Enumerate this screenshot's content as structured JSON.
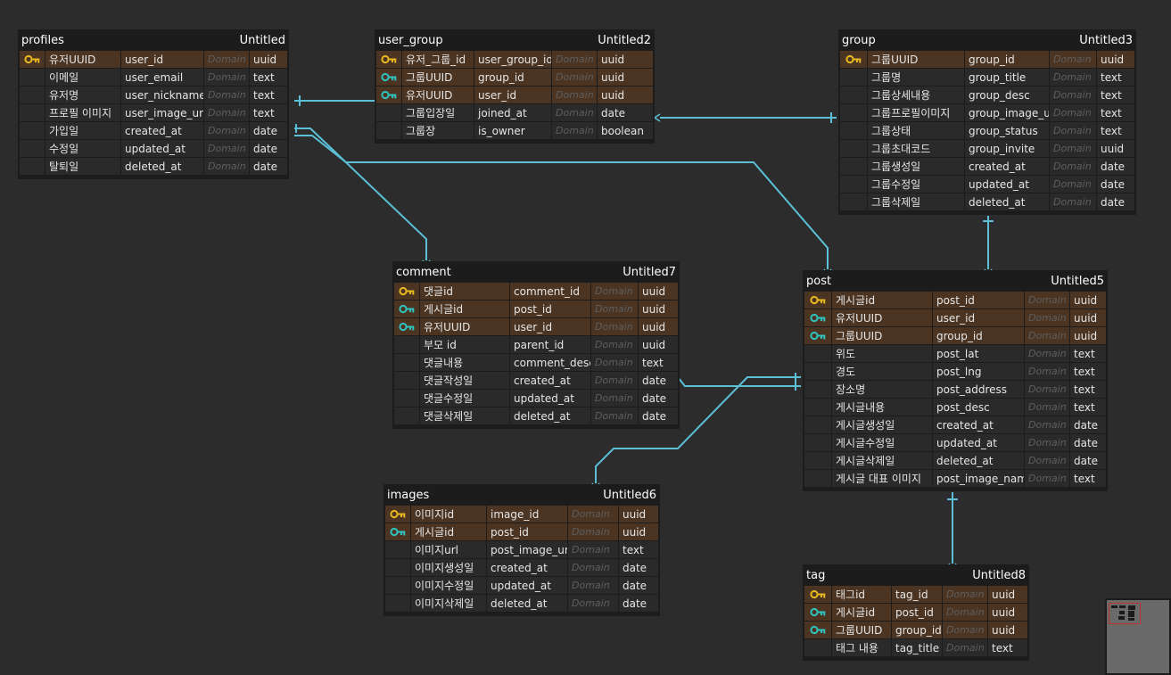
{
  "colors": {
    "background": "#2c2c2c",
    "table_bg": "#1c1c1c",
    "pk_row": "#4b3422",
    "row": "#2a2a2a",
    "link": "#5bc0d6",
    "primary_key_icon": "#e8b820",
    "foreign_key_icon": "#2fc3c0"
  },
  "tables": [
    {
      "id": "profiles",
      "name": "profiles",
      "label": "Untitled",
      "rows": [
        {
          "key": "primary-key-icon",
          "logical": "유저UUID",
          "physical": "user_id",
          "domain": "Domain",
          "type": "uuid"
        },
        {
          "key": "",
          "logical": "이메일",
          "physical": "user_email",
          "domain": "Domain",
          "type": "text"
        },
        {
          "key": "",
          "logical": "유저명",
          "physical": "user_nickname",
          "domain": "Domain",
          "type": "text"
        },
        {
          "key": "",
          "logical": "프로필 이미지",
          "physical": "user_image_url",
          "domain": "Domain",
          "type": "text"
        },
        {
          "key": "",
          "logical": "가입일",
          "physical": "created_at",
          "domain": "Domain",
          "type": "date"
        },
        {
          "key": "",
          "logical": "수정일",
          "physical": "updated_at",
          "domain": "Domain",
          "type": "date"
        },
        {
          "key": "",
          "logical": "탈퇴일",
          "physical": "deleted_at",
          "domain": "Domain",
          "type": "date"
        }
      ]
    },
    {
      "id": "user_group",
      "name": "user_group",
      "label": "Untitled2",
      "rows": [
        {
          "key": "primary-key-icon",
          "logical": "유저_그룹_id",
          "physical": "user_group_id",
          "domain": "Domain",
          "type": "uuid"
        },
        {
          "key": "foreign-key-icon",
          "logical": "그룹UUID",
          "physical": "group_id",
          "domain": "Domain",
          "type": "uuid"
        },
        {
          "key": "foreign-key-icon",
          "logical": "유저UUID",
          "physical": "user_id",
          "domain": "Domain",
          "type": "uuid"
        },
        {
          "key": "",
          "logical": "그룹입장일",
          "physical": "joined_at",
          "domain": "Domain",
          "type": "date"
        },
        {
          "key": "",
          "logical": "그룹장",
          "physical": "is_owner",
          "domain": "Domain",
          "type": "boolean"
        }
      ]
    },
    {
      "id": "group",
      "name": "group",
      "label": "Untitled3",
      "rows": [
        {
          "key": "primary-key-icon",
          "logical": "그룹UUID",
          "physical": "group_id",
          "domain": "Domain",
          "type": "uuid"
        },
        {
          "key": "",
          "logical": "그룹명",
          "physical": "group_title",
          "domain": "Domain",
          "type": "text"
        },
        {
          "key": "",
          "logical": "그룹상세내용",
          "physical": "group_desc",
          "domain": "Domain",
          "type": "text"
        },
        {
          "key": "",
          "logical": "그룹프로필이미지",
          "physical": "group_image_url",
          "domain": "Domain",
          "type": "text"
        },
        {
          "key": "",
          "logical": "그룹상태",
          "physical": "group_status",
          "domain": "Domain",
          "type": "text"
        },
        {
          "key": "",
          "logical": "그룹초대코드",
          "physical": "group_invite",
          "domain": "Domain",
          "type": "uuid"
        },
        {
          "key": "",
          "logical": "그룹생성일",
          "physical": "created_at",
          "domain": "Domain",
          "type": "date"
        },
        {
          "key": "",
          "logical": "그룹수정일",
          "physical": "updated_at",
          "domain": "Domain",
          "type": "date"
        },
        {
          "key": "",
          "logical": "그룹삭제일",
          "physical": "deleted_at",
          "domain": "Domain",
          "type": "date"
        }
      ]
    },
    {
      "id": "comment",
      "name": "comment",
      "label": "Untitled7",
      "rows": [
        {
          "key": "primary-key-icon",
          "logical": "댓글id",
          "physical": "comment_id",
          "domain": "Domain",
          "type": "uuid"
        },
        {
          "key": "foreign-key-icon",
          "logical": "게시글id",
          "physical": "post_id",
          "domain": "Domain",
          "type": "uuid"
        },
        {
          "key": "foreign-key-icon",
          "logical": "유저UUID",
          "physical": "user_id",
          "domain": "Domain",
          "type": "uuid"
        },
        {
          "key": "",
          "logical": "부모 id",
          "physical": "parent_id",
          "domain": "Domain",
          "type": "uuid"
        },
        {
          "key": "",
          "logical": "댓글내용",
          "physical": "comment_desc",
          "domain": "Domain",
          "type": "text"
        },
        {
          "key": "",
          "logical": "댓글작성일",
          "physical": "created_at",
          "domain": "Domain",
          "type": "date"
        },
        {
          "key": "",
          "logical": "댓글수정일",
          "physical": "updated_at",
          "domain": "Domain",
          "type": "date"
        },
        {
          "key": "",
          "logical": "댓글삭제일",
          "physical": "deleted_at",
          "domain": "Domain",
          "type": "date"
        }
      ]
    },
    {
      "id": "post",
      "name": "post",
      "label": "Untitled5",
      "rows": [
        {
          "key": "primary-key-icon",
          "logical": "게시글id",
          "physical": "post_id",
          "domain": "Domain",
          "type": "uuid"
        },
        {
          "key": "foreign-key-icon",
          "logical": "유저UUID",
          "physical": "user_id",
          "domain": "Domain",
          "type": "uuid"
        },
        {
          "key": "foreign-key-icon",
          "logical": "그룹UUID",
          "physical": "group_id",
          "domain": "Domain",
          "type": "uuid"
        },
        {
          "key": "",
          "logical": "위도",
          "physical": "post_lat",
          "domain": "Domain",
          "type": "text"
        },
        {
          "key": "",
          "logical": "경도",
          "physical": "post_lng",
          "domain": "Domain",
          "type": "text"
        },
        {
          "key": "",
          "logical": "장소명",
          "physical": "post_address",
          "domain": "Domain",
          "type": "text"
        },
        {
          "key": "",
          "logical": "게시글내용",
          "physical": "post_desc",
          "domain": "Domain",
          "type": "text"
        },
        {
          "key": "",
          "logical": "게시글생성일",
          "physical": "created_at",
          "domain": "Domain",
          "type": "date"
        },
        {
          "key": "",
          "logical": "게시글수정일",
          "physical": "updated_at",
          "domain": "Domain",
          "type": "date"
        },
        {
          "key": "",
          "logical": "게시글삭제일",
          "physical": "deleted_at",
          "domain": "Domain",
          "type": "date"
        },
        {
          "key": "",
          "logical": "게시글 대표 이미지",
          "physical": "post_image_name",
          "domain": "Domain",
          "type": "text"
        }
      ]
    },
    {
      "id": "images",
      "name": "images",
      "label": "Untitled6",
      "rows": [
        {
          "key": "primary-key-icon",
          "logical": "이미지id",
          "physical": "image_id",
          "domain": "Domain",
          "type": "uuid"
        },
        {
          "key": "foreign-key-icon",
          "logical": "게시글id",
          "physical": "post_id",
          "domain": "Domain",
          "type": "uuid"
        },
        {
          "key": "",
          "logical": "이미지url",
          "physical": "post_image_url",
          "domain": "Domain",
          "type": "text"
        },
        {
          "key": "",
          "logical": "이미지생성일",
          "physical": "created_at",
          "domain": "Domain",
          "type": "date"
        },
        {
          "key": "",
          "logical": "이미지수정일",
          "physical": "updated_at",
          "domain": "Domain",
          "type": "date"
        },
        {
          "key": "",
          "logical": "이미지삭제일",
          "physical": "deleted_at",
          "domain": "Domain",
          "type": "date"
        }
      ]
    },
    {
      "id": "tag",
      "name": "tag",
      "label": "Untitled8",
      "rows": [
        {
          "key": "primary-key-icon",
          "logical": "태그id",
          "physical": "tag_id",
          "domain": "Domain",
          "type": "uuid"
        },
        {
          "key": "foreign-key-icon",
          "logical": "게시글id",
          "physical": "post_id",
          "domain": "Domain",
          "type": "uuid"
        },
        {
          "key": "foreign-key-icon",
          "logical": "그룹UUID",
          "physical": "group_id",
          "domain": "Domain",
          "type": "uuid"
        },
        {
          "key": "",
          "logical": "태그 내용",
          "physical": "tag_title",
          "domain": "Domain",
          "type": "text"
        }
      ]
    }
  ],
  "relationships": [
    {
      "from": "profiles",
      "to": "user_group"
    },
    {
      "from": "group",
      "to": "user_group"
    },
    {
      "from": "profiles",
      "to": "comment"
    },
    {
      "from": "profiles",
      "to": "post"
    },
    {
      "from": "group",
      "to": "post"
    },
    {
      "from": "post",
      "to": "comment"
    },
    {
      "from": "post",
      "to": "images"
    },
    {
      "from": "post",
      "to": "tag"
    }
  ]
}
